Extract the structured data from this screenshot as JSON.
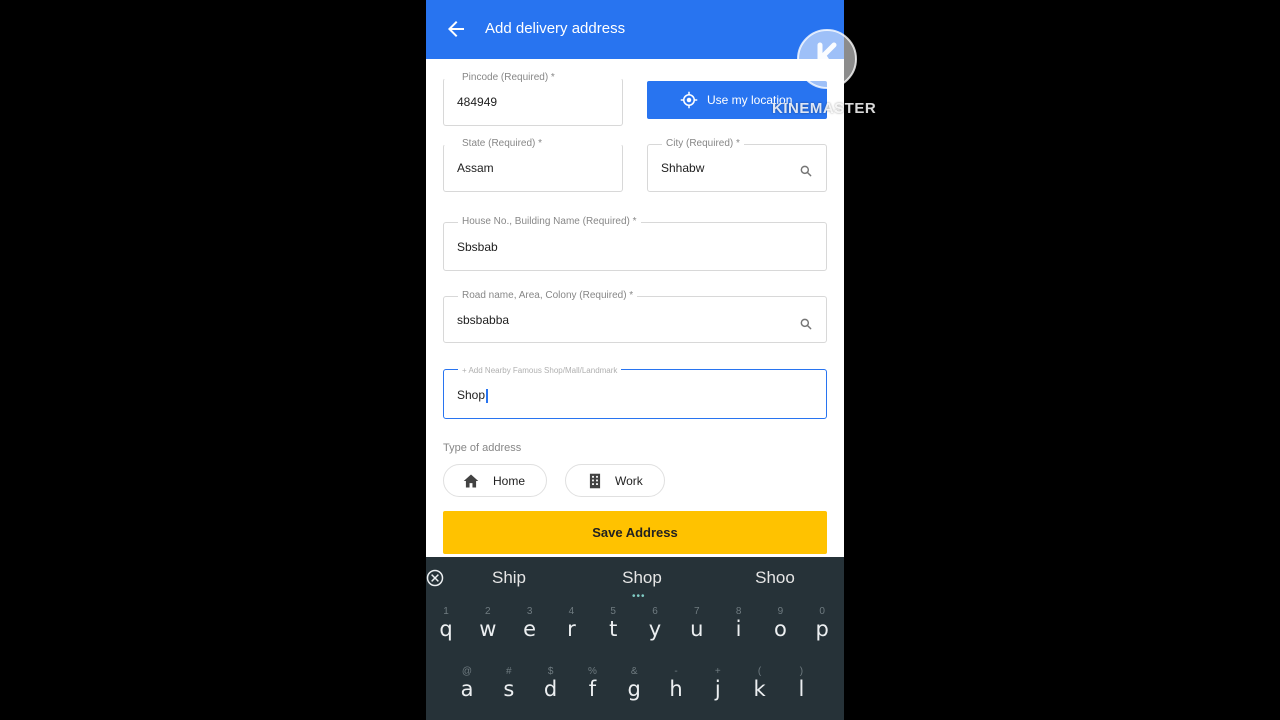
{
  "appbar": {
    "title": "Add delivery address"
  },
  "form": {
    "pincode": {
      "label": "Pincode (Required) *",
      "value": "484949"
    },
    "use_location_label": "Use my location",
    "state": {
      "label": "State (Required) *",
      "value": "Assam"
    },
    "city": {
      "label": "City (Required) *",
      "value": "Shhabw"
    },
    "house": {
      "label": "House No., Building Name (Required) *",
      "value": "Sbsbab"
    },
    "road": {
      "label": "Road name, Area, Colony (Required) *",
      "value": "sbsbabba"
    },
    "landmark": {
      "label": "+ Add Nearby Famous Shop/Mall/Landmark",
      "value": "Shop"
    },
    "type_label": "Type of address",
    "types": [
      {
        "label": "Home",
        "icon": "home-icon"
      },
      {
        "label": "Work",
        "icon": "office-building-icon"
      }
    ],
    "save_label": "Save Address"
  },
  "keyboard": {
    "suggestions": [
      "Ship",
      "Shop",
      "Shoo"
    ],
    "row1": [
      {
        "char": "q",
        "hint": "1"
      },
      {
        "char": "w",
        "hint": "2"
      },
      {
        "char": "e",
        "hint": "3"
      },
      {
        "char": "r",
        "hint": "4"
      },
      {
        "char": "t",
        "hint": "5"
      },
      {
        "char": "y",
        "hint": "6"
      },
      {
        "char": "u",
        "hint": "7"
      },
      {
        "char": "i",
        "hint": "8"
      },
      {
        "char": "o",
        "hint": "9"
      },
      {
        "char": "p",
        "hint": "0"
      }
    ],
    "row2": [
      {
        "char": "a",
        "hint": "@"
      },
      {
        "char": "s",
        "hint": "#"
      },
      {
        "char": "d",
        "hint": "$"
      },
      {
        "char": "f",
        "hint": "%"
      },
      {
        "char": "g",
        "hint": "&"
      },
      {
        "char": "h",
        "hint": "-"
      },
      {
        "char": "j",
        "hint": "+"
      },
      {
        "char": "k",
        "hint": "("
      },
      {
        "char": "l",
        "hint": ")"
      }
    ]
  },
  "watermark": {
    "text": "KINEMASTER"
  },
  "colors": {
    "primary": "#2874f0",
    "accent": "#ffc200",
    "keyboard_bg": "#263238"
  }
}
